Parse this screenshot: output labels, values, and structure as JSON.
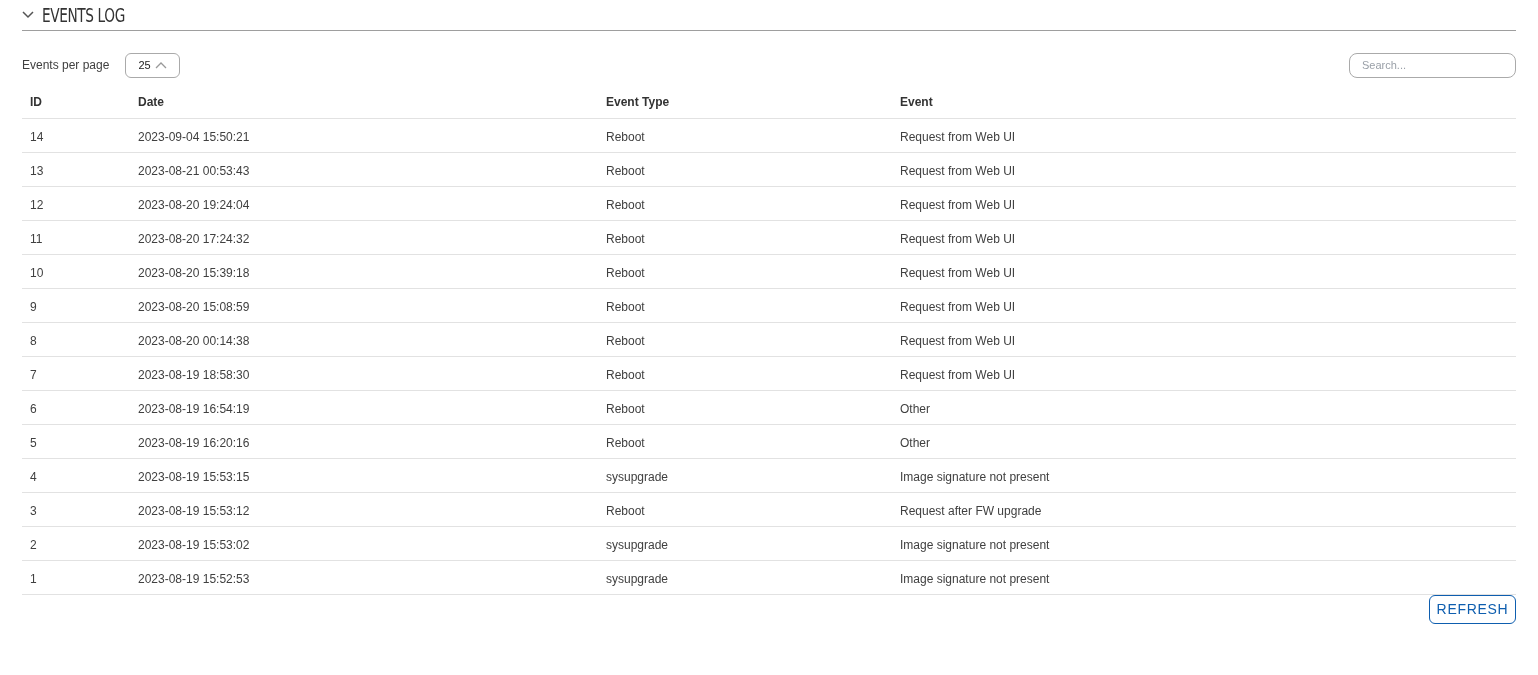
{
  "section": {
    "title": "EVENTS LOG",
    "expanded": true
  },
  "per_page": {
    "label": "Events per page",
    "value": "25"
  },
  "search": {
    "placeholder": "Search..."
  },
  "table": {
    "columns": [
      "ID",
      "Date",
      "Event Type",
      "Event"
    ],
    "rows": [
      [
        "14",
        "2023-09-04 15:50:21",
        "Reboot",
        "Request from Web UI"
      ],
      [
        "13",
        "2023-08-21 00:53:43",
        "Reboot",
        "Request from Web UI"
      ],
      [
        "12",
        "2023-08-20 19:24:04",
        "Reboot",
        "Request from Web UI"
      ],
      [
        "11",
        "2023-08-20 17:24:32",
        "Reboot",
        "Request from Web UI"
      ],
      [
        "10",
        "2023-08-20 15:39:18",
        "Reboot",
        "Request from Web UI"
      ],
      [
        "9",
        "2023-08-20 15:08:59",
        "Reboot",
        "Request from Web UI"
      ],
      [
        "8",
        "2023-08-20 00:14:38",
        "Reboot",
        "Request from Web UI"
      ],
      [
        "7",
        "2023-08-19 18:58:30",
        "Reboot",
        "Request from Web UI"
      ],
      [
        "6",
        "2023-08-19 16:54:19",
        "Reboot",
        "Other"
      ],
      [
        "5",
        "2023-08-19 16:20:16",
        "Reboot",
        "Other"
      ],
      [
        "4",
        "2023-08-19 15:53:15",
        "sysupgrade",
        "Image signature not present"
      ],
      [
        "3",
        "2023-08-19 15:53:12",
        "Reboot",
        "Request after FW upgrade"
      ],
      [
        "2",
        "2023-08-19 15:53:02",
        "sysupgrade",
        "Image signature not present"
      ],
      [
        "1",
        "2023-08-19 15:52:53",
        "sysupgrade",
        "Image signature not present"
      ]
    ]
  },
  "refresh_button": "REFRESH"
}
